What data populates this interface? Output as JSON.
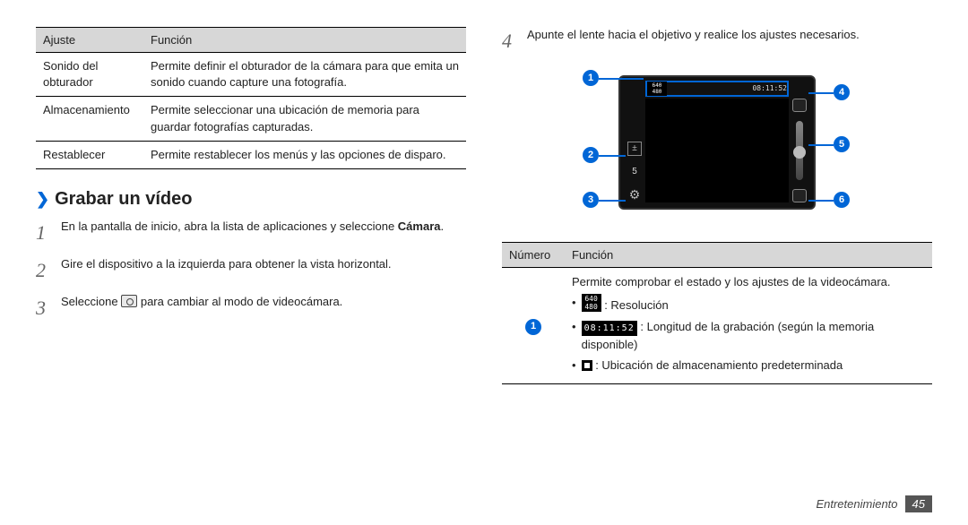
{
  "left": {
    "table_headers": {
      "c1": "Ajuste",
      "c2": "Función"
    },
    "rows": [
      {
        "name": "Sonido del obturador",
        "desc": "Permite definir el obturador de la cámara para que emita un sonido cuando capture una fotografía."
      },
      {
        "name": "Almacenamiento",
        "desc": "Permite seleccionar una ubicación de memoria para guardar fotografías capturadas."
      },
      {
        "name": "Restablecer",
        "desc": "Permite restablecer los menús y las opciones de disparo."
      }
    ],
    "section_title": "Grabar un vídeo",
    "steps": {
      "s1_num": "1",
      "s1a": "En la pantalla de inicio, abra la lista de aplicaciones y seleccione ",
      "s1b": "Cámara",
      "s1c": ".",
      "s2_num": "2",
      "s2": "Gire el dispositivo a la izquierda para obtener la vista horizontal.",
      "s3_num": "3",
      "s3a": "Seleccione ",
      "s3b": " para cambiar al modo de videocámara."
    }
  },
  "right": {
    "step4_num": "4",
    "step4": "Apunte el lente hacia el objetivo y realice los ajustes necesarios.",
    "callouts": {
      "n1": "1",
      "n2": "2",
      "n3": "3",
      "n4": "4",
      "n5": "5",
      "n6": "6"
    },
    "diagram": {
      "ev_label": "5",
      "time_label": "08:11:52",
      "res_label": "640\n480"
    },
    "table_headers": {
      "c1": "Número",
      "c2": "Función"
    },
    "row1_badge": "1",
    "row1_intro": "Permite comprobar el estado y los ajustes de la videocámara.",
    "row1_b1_pre": "",
    "row1_b1_icon": "640\n480",
    "row1_b1_post": ": Resolución",
    "row1_b2_icon": "08:11:52",
    "row1_b2_post": ": Longitud de la grabación (según la memoria disponible)",
    "row1_b3_post": ": Ubicación de almacenamiento predeterminada"
  },
  "footer": {
    "label": "Entretenimiento",
    "page": "45"
  }
}
